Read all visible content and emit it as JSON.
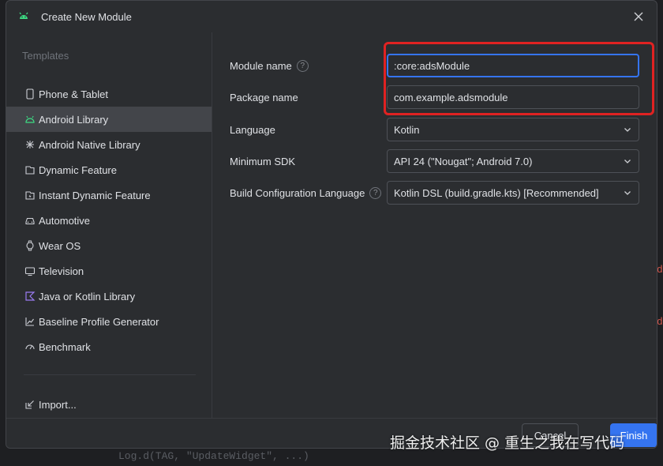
{
  "window": {
    "title": "Create New Module"
  },
  "sidebar": {
    "heading": "Templates",
    "items": [
      {
        "label": "Phone & Tablet",
        "icon": "phone-icon"
      },
      {
        "label": "Android Library",
        "icon": "android-icon",
        "selected": true
      },
      {
        "label": "Android Native Library",
        "icon": "native-library-icon"
      },
      {
        "label": "Dynamic Feature",
        "icon": "dynamic-feature-icon"
      },
      {
        "label": "Instant Dynamic Feature",
        "icon": "instant-feature-icon"
      },
      {
        "label": "Automotive",
        "icon": "car-icon"
      },
      {
        "label": "Wear OS",
        "icon": "watch-icon"
      },
      {
        "label": "Television",
        "icon": "tv-icon"
      },
      {
        "label": "Java or Kotlin Library",
        "icon": "kotlin-icon"
      },
      {
        "label": "Baseline Profile Generator",
        "icon": "chart-icon"
      },
      {
        "label": "Benchmark",
        "icon": "gauge-icon"
      }
    ],
    "import_label": "Import..."
  },
  "form": {
    "module_name": {
      "label": "Module name",
      "value": ":core:adsModule"
    },
    "package_name": {
      "label": "Package name",
      "value": "com.example.adsmodule"
    },
    "language": {
      "label": "Language",
      "value": "Kotlin"
    },
    "min_sdk": {
      "label": "Minimum SDK",
      "value": "API 24 (\"Nougat\"; Android 7.0)"
    },
    "build_config_language": {
      "label": "Build Configuration Language",
      "value": "Kotlin DSL (build.gradle.kts) [Recommended]"
    }
  },
  "footer": {
    "cancel_label": "Cancel",
    "finish_label": "Finish"
  },
  "watermark": "掘金技术社区 @ 重生之我在写代码",
  "editor": {
    "mark_char": "d",
    "bottom_text": "Log.d(TAG, \"UpdateWidget\", ...)"
  },
  "colors": {
    "accent": "#3574f0",
    "highlight": "#e02222",
    "android_green": "#3ddc84"
  }
}
